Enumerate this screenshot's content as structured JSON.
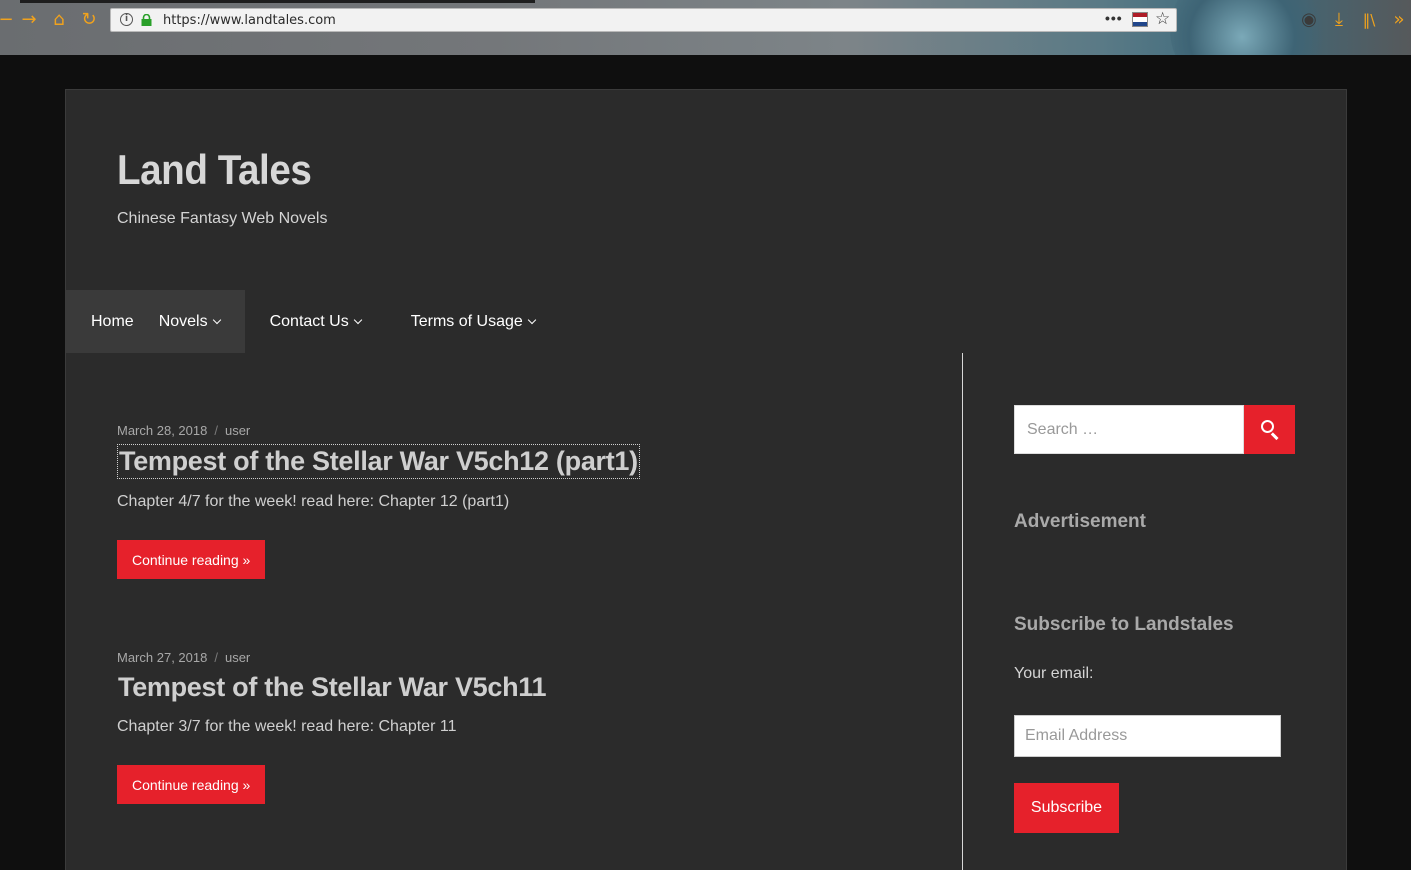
{
  "browser": {
    "url": "https://www.landtales.com",
    "colors": {
      "toolbar_icon": "#f0a21d"
    }
  },
  "site": {
    "title": "Land Tales",
    "description": "Chinese Fantasy Web Novels"
  },
  "nav": {
    "items": [
      {
        "label": "Home",
        "has_dropdown": false,
        "active": true
      },
      {
        "label": "Novels",
        "has_dropdown": true,
        "active": true
      },
      {
        "label": "Contact Us",
        "has_dropdown": true,
        "active": false
      },
      {
        "label": "Terms of Usage",
        "has_dropdown": true,
        "active": false
      }
    ]
  },
  "posts": [
    {
      "date": "March 28, 2018",
      "author": "user",
      "title": "Tempest of the Stellar War V5ch12 (part1)",
      "excerpt": "Chapter  4/7  for the week! read here: Chapter 12 (part1)",
      "button": "Continue reading »"
    },
    {
      "date": "March 27, 2018",
      "author": "user",
      "title": "Tempest of the Stellar War V5ch11",
      "excerpt": "Chapter  3/7  for the week! read here: Chapter 11",
      "button": "Continue reading »"
    }
  ],
  "meta_separator": "/",
  "sidebar": {
    "search_placeholder": "Search …",
    "advertisement_title": "Advertisement",
    "subscribe_title": "Subscribe to Landstales",
    "email_label": "Your email:",
    "email_placeholder": "Email Address",
    "subscribe_button": "Subscribe"
  },
  "colors": {
    "accent": "#e6212b",
    "page_bg": "#2b2b2b",
    "outer_bg": "#0f0f0f"
  }
}
